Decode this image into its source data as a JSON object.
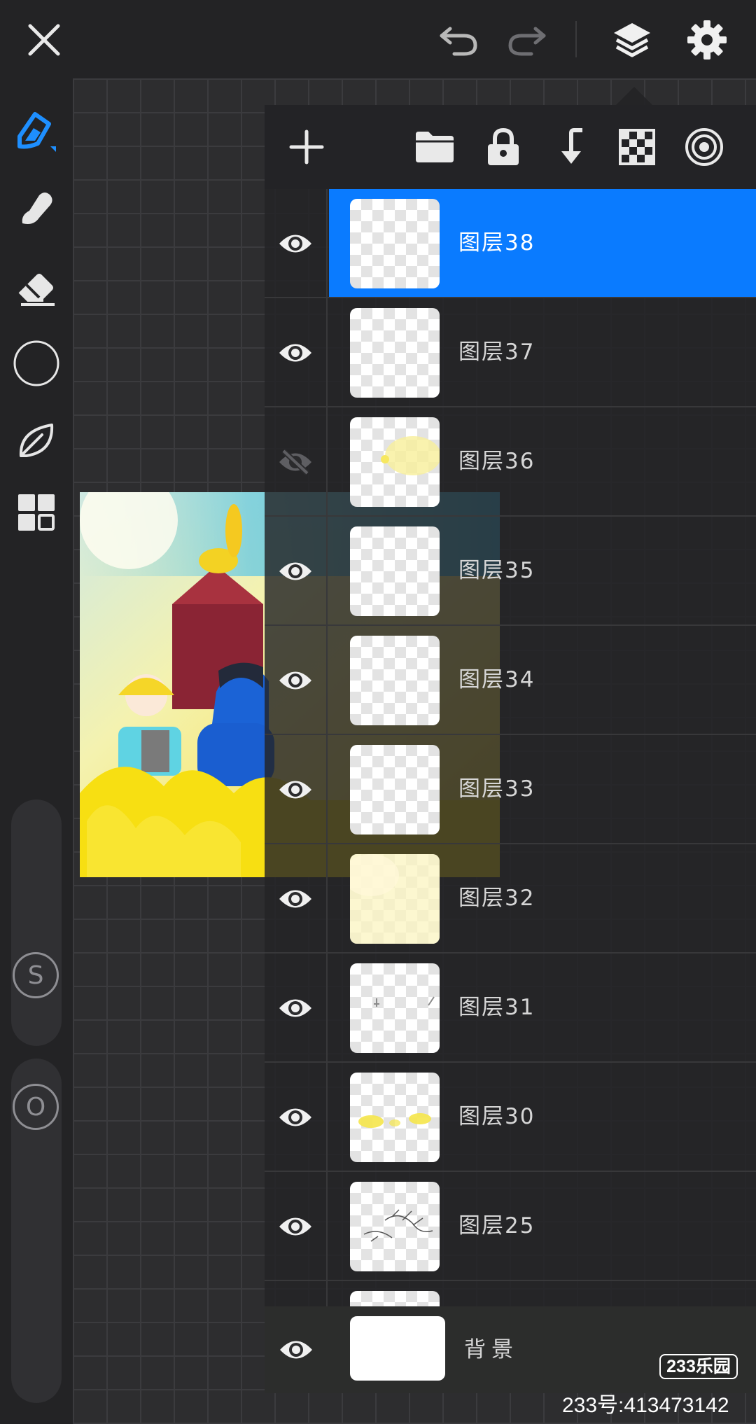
{
  "colors": {
    "accent": "#0a7bff",
    "topbar": "#232325",
    "panel": "#232326",
    "canvas_bg": "#2d2d2f"
  },
  "topbar": {
    "close_icon": "close-icon",
    "undo_icon": "undo-icon",
    "redo_icon": "redo-icon",
    "layers_icon": "layers-icon",
    "settings_icon": "gear-icon"
  },
  "left_tools": [
    {
      "name": "brush-tool",
      "icon": "pen-icon"
    },
    {
      "name": "smudge-tool",
      "icon": "smudge-icon"
    },
    {
      "name": "eraser-tool",
      "icon": "eraser-icon"
    },
    {
      "name": "color-tool",
      "icon": "color-circle-icon"
    },
    {
      "name": "leaf-tool",
      "icon": "leaf-icon"
    },
    {
      "name": "grid-tool",
      "icon": "grid-icon"
    }
  ],
  "sliders": {
    "size_label": "S",
    "opacity_label": "O"
  },
  "layer_toolbar": [
    {
      "name": "add-layer",
      "icon": "plus-icon"
    },
    {
      "name": "group-layer",
      "icon": "folder-icon"
    },
    {
      "name": "lock-layer",
      "icon": "lock-icon"
    },
    {
      "name": "merge-down",
      "icon": "merge-down-icon"
    },
    {
      "name": "transparency",
      "icon": "checker-icon"
    },
    {
      "name": "target",
      "icon": "target-icon"
    }
  ],
  "layers": [
    {
      "name": "图层38",
      "visible": true,
      "selected": true
    },
    {
      "name": "图层37",
      "visible": true,
      "selected": false
    },
    {
      "name": "图层36",
      "visible": false,
      "selected": false
    },
    {
      "name": "图层35",
      "visible": true,
      "selected": false
    },
    {
      "name": "图层34",
      "visible": true,
      "selected": false
    },
    {
      "name": "图层33",
      "visible": true,
      "selected": false
    },
    {
      "name": "图层32",
      "visible": true,
      "selected": false
    },
    {
      "name": "图层31",
      "visible": true,
      "selected": false
    },
    {
      "name": "图层30",
      "visible": true,
      "selected": false
    },
    {
      "name": "图层25",
      "visible": true,
      "selected": false
    }
  ],
  "background_layer": {
    "name": "背景",
    "visible": true
  },
  "watermark": {
    "badge": "233乐园",
    "id": "233号:413473142"
  }
}
